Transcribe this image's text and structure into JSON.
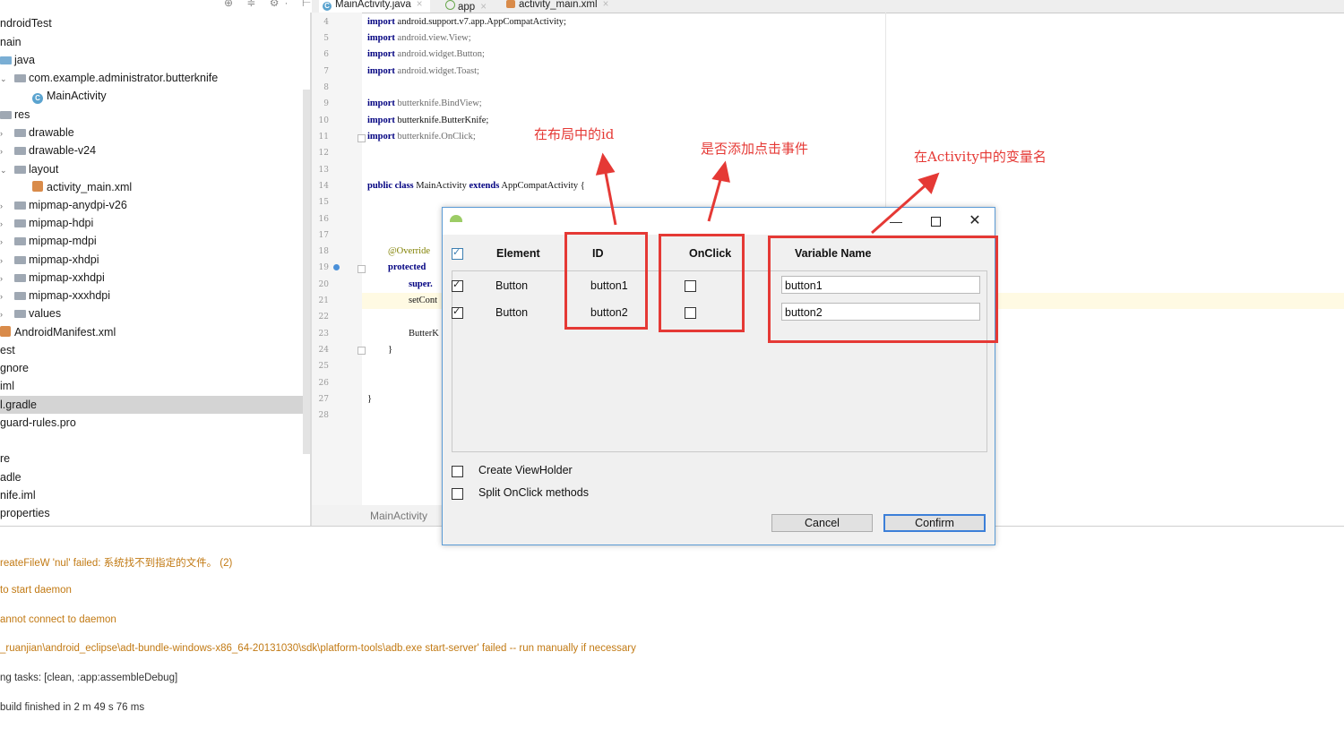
{
  "tabs": [
    {
      "label": "MainActivity.java",
      "icon": "class-icon",
      "active": true
    },
    {
      "label": "app",
      "icon": "module-icon",
      "active": false
    },
    {
      "label": "activity_main.xml",
      "icon": "xml-file-icon",
      "active": false
    }
  ],
  "tree": {
    "items": [
      {
        "label": "ndroidTest"
      },
      {
        "label": "nain"
      },
      {
        "label": "java"
      },
      {
        "label": "com.example.administrator.butterknife"
      },
      {
        "label": "MainActivity"
      },
      {
        "label": "res"
      },
      {
        "label": "drawable"
      },
      {
        "label": "drawable-v24"
      },
      {
        "label": "layout"
      },
      {
        "label": "activity_main.xml"
      },
      {
        "label": "mipmap-anydpi-v26"
      },
      {
        "label": "mipmap-hdpi"
      },
      {
        "label": "mipmap-mdpi"
      },
      {
        "label": "mipmap-xhdpi"
      },
      {
        "label": "mipmap-xxhdpi"
      },
      {
        "label": "mipmap-xxxhdpi"
      },
      {
        "label": "values"
      },
      {
        "label": "AndroidManifest.xml"
      },
      {
        "label": "est"
      },
      {
        "label": "gnore"
      },
      {
        "label": "iml"
      },
      {
        "label": "l.gradle"
      },
      {
        "label": "guard-rules.pro"
      },
      {
        "label": "re"
      },
      {
        "label": "adle"
      },
      {
        "label": "nife.iml"
      },
      {
        "label": "properties"
      }
    ]
  },
  "editor": {
    "line_numbers": [
      "4",
      "5",
      "6",
      "7",
      "8",
      "9",
      "10",
      "11",
      "12",
      "13",
      "14",
      "15",
      "16",
      "17",
      "18",
      "19",
      "20",
      "21",
      "22",
      "23",
      "24",
      "25",
      "26",
      "27",
      "28"
    ],
    "lines": {
      "l4": [
        "import",
        " android.support.v7.app.AppCompatActivity;"
      ],
      "l5": [
        "import",
        " android.view.View;"
      ],
      "l6": [
        "import",
        " android.widget.Button;"
      ],
      "l7": [
        "import",
        " android.widget.Toast;"
      ],
      "l9": [
        "import",
        " butterknife.BindView;"
      ],
      "l10": [
        "import",
        " butterknife.ButterKnife;"
      ],
      "l11": [
        "import",
        " butterknife.OnClick;"
      ],
      "l14": [
        "public class",
        " MainActivity ",
        "extends",
        " AppCompatActivity {"
      ],
      "l18": "@Override",
      "l19": "protected",
      "l20": "super.",
      "l21": "setCont",
      "l23": "ButterK",
      "l24": "}",
      "l27": "}"
    },
    "breadcrumb": "MainActivity"
  },
  "console": {
    "lines": [
      {
        "text": "reateFileW 'nul' failed: 系统找不到指定的文件。 (2)",
        "kind": "warn"
      },
      {
        "text": " to start daemon",
        "kind": "warn"
      },
      {
        "text": "annot connect to daemon",
        "kind": "warn"
      },
      {
        "text": "_ruanjian\\android_eclipse\\adt-bundle-windows-x86_64-20131030\\sdk\\platform-tools\\adb.exe start-server' failed -- run manually if necessary",
        "kind": "warn"
      },
      {
        "text": "ng tasks: [clean, :app:assembleDebug]",
        "kind": "norm"
      },
      {
        "text": " build finished in 2 m 49 s 76 ms",
        "kind": "norm"
      }
    ]
  },
  "dialog": {
    "icon": "android-icon",
    "headers": {
      "element": "Element",
      "id": "ID",
      "onclick": "OnClick",
      "variable": "Variable Name"
    },
    "select_all_checked": true,
    "rows": [
      {
        "checked": true,
        "element": "Button",
        "id": "button1",
        "onclick": false,
        "variable": "button1"
      },
      {
        "checked": true,
        "element": "Button",
        "id": "button2",
        "onclick": false,
        "variable": "button2"
      }
    ],
    "options": [
      {
        "label": "Create ViewHolder",
        "checked": false
      },
      {
        "label": "Split OnClick methods",
        "checked": false
      }
    ],
    "cancel_label": "Cancel",
    "confirm_label": "Confirm"
  },
  "annotations": {
    "id_note": "在布局中的id",
    "onclick_note": "是否添加点击事件",
    "variable_note": "在Activity中的变量名",
    "color": "#e53935"
  }
}
